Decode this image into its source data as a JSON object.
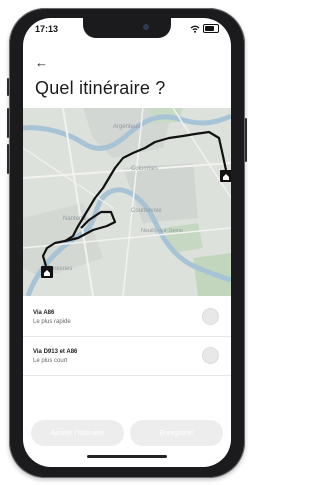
{
  "status": {
    "time": "17:13"
  },
  "nav": {
    "back": "←"
  },
  "page": {
    "title": "Quel itinéraire ?"
  },
  "map": {
    "places": [
      "Argenteuil",
      "Colombes",
      "Courbevoie",
      "Neuilly-sur-Seine",
      "Nanterre",
      "Suresnes"
    ],
    "start_icon": "home-marker-icon",
    "end_icon": "destination-marker-icon",
    "route_color": "#111111"
  },
  "routes": [
    {
      "name": "Via A86",
      "subtitle": "Le plus rapide"
    },
    {
      "name": "Via D913 et A86",
      "subtitle": "Le plus court"
    }
  ],
  "actions": {
    "add": "Ajouter l'itinéraire",
    "save": "Enregistrer"
  },
  "colors": {
    "map_bg": "#d9ddd8",
    "water": "#a7c4d6",
    "button_bg": "#ededed"
  }
}
